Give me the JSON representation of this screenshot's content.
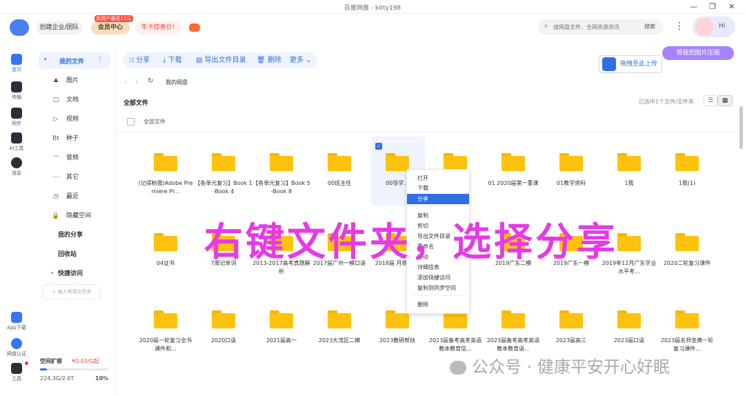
{
  "window": {
    "title": "百度网盘 - kitty198"
  },
  "header": {
    "create_team": "创建企业/团队",
    "promo_tag": "新用户最低12元",
    "member_center": "会员中心",
    "annual": "年卡惊喜价!",
    "search_placeholder": "搜网盘文件、全网资源资讯",
    "search_button": "搜索",
    "hi": "Hi",
    "compress_tip": "帮我把图片压缩",
    "drag_upload": "拖拽至此上传"
  },
  "iconbar": {
    "home": "首页",
    "transfer": "传输",
    "sync": "同步",
    "ai": "AI工具",
    "messages": "消息",
    "app": "App下载",
    "verify": "网盘认证",
    "tools": "工具"
  },
  "nav": {
    "my_files": "我的文件",
    "items": [
      "图片",
      "文档",
      "视频",
      "种子",
      "音频",
      "其它",
      "最近",
      "隐藏空间"
    ],
    "glyphs": [
      "⛰",
      "▢",
      "▷",
      "Bt",
      "◠",
      "⋯",
      "◷",
      "🔒"
    ],
    "my_share": "我的分享",
    "recycle": "回收站",
    "quick": "快捷访问",
    "add_common": "+ 拖入常用文件夹",
    "storage_label": "空间扩容",
    "storage_price": "¥0.03/G起",
    "storage_used": "224.3G/2.0T",
    "storage_pct": "10%",
    "storage_fraction": 0.1
  },
  "toolbar": {
    "share": "分享",
    "download": "下载",
    "export": "导出文件目录",
    "delete": "删除",
    "more": "更多"
  },
  "breadcrumb": {
    "current": "我的网盘"
  },
  "list": {
    "title": "全部文件",
    "selected_info": "已选中1个文件/文件夹",
    "select_all": "全部文件"
  },
  "folders": [
    [
      "(记得粉我)Adobe Premiere Pr...",
      "【各单元复习】Book 1-Book 4",
      "【各单元复习】Book 5-Book 8",
      "00班主任",
      "00导学...",
      "",
      "01 2020届第一董课",
      "01教学资料",
      "1我",
      "1我(1)"
    ],
    [
      "04证书",
      "7周记单词",
      "2013-2017高考真题解析",
      "2017届广州一模口语",
      "2018届 月练1 10",
      "",
      "2019广东二模",
      "2019广东一模",
      "2019年12月广东学业水平考...",
      "2020二轮复习课件"
    ],
    [
      "2020届一轮复习全书课件和...",
      "2020口语",
      "2021届高一",
      "2023大湾区二模",
      "2023教研帮扶",
      "2023届备考高考英语教本教育信...",
      "2023届备考高考英语教本教育语...",
      "2023届高三",
      "2023届口语",
      "2023届名师金典一轮复习课件..."
    ]
  ],
  "context_menu": [
    "打开",
    "下载",
    "分享",
    "复制",
    "剪切",
    "导出文件目录",
    "重命名",
    "移动",
    "详细信息",
    "添加快捷访问",
    "复制到同步空间",
    "删除"
  ],
  "overlay": "右键文件夹，选择分享",
  "watermark": "公众号 · 健康平安开心好眠"
}
